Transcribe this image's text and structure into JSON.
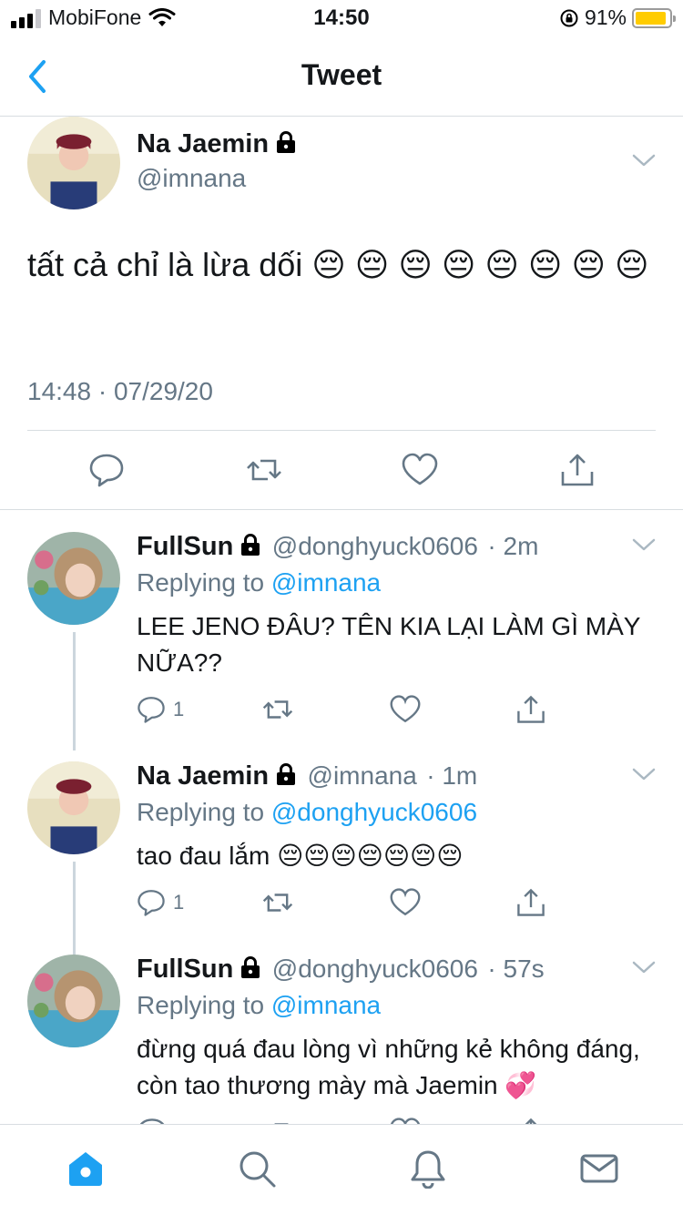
{
  "status_bar": {
    "carrier": "MobiFone",
    "time": "14:50",
    "battery": "91%",
    "battery_level": 0.91
  },
  "nav": {
    "title": "Tweet",
    "back_icon": "chevron-left-icon"
  },
  "main_tweet": {
    "author_name": "Na Jaemin",
    "handle": "@imnana",
    "text": "tất cả chỉ là lừa dối 😔 😔 😔 😔 😔 😔 😔 😔",
    "timestamp": "14:48 · 07/29/20"
  },
  "replies": [
    {
      "author_name": "FullSun",
      "handle": "@donghyuck0606",
      "time": "· 2m",
      "replying_prefix": "Replying to",
      "replying_to": "@imnana",
      "text": "LEE JENO ĐÂU? TÊN KIA LẠI LÀM GÌ MÀY NỮA??",
      "reply_count": "1"
    },
    {
      "author_name": "Na Jaemin",
      "handle": "@imnana",
      "time": "· 1m",
      "replying_prefix": "Replying to",
      "replying_to": "@donghyuck0606",
      "text": "tao đau lắm 😔😔😔😔😔😔😔",
      "reply_count": "1"
    },
    {
      "author_name": "FullSun",
      "handle": "@donghyuck0606",
      "time": "· 57s",
      "replying_prefix": "Replying to",
      "replying_to": "@imnana",
      "text": "đừng quá đau lòng vì những kẻ không đáng, còn tao thương mày mà Jaemin 💞",
      "reply_count": ""
    }
  ],
  "tabs": [
    "home-icon",
    "search-icon",
    "notifications-icon",
    "messages-icon"
  ],
  "colors": {
    "accent": "#1da1f2",
    "secondary_text": "#657786",
    "divider": "#d8dde1",
    "battery": "#ffcc00"
  }
}
